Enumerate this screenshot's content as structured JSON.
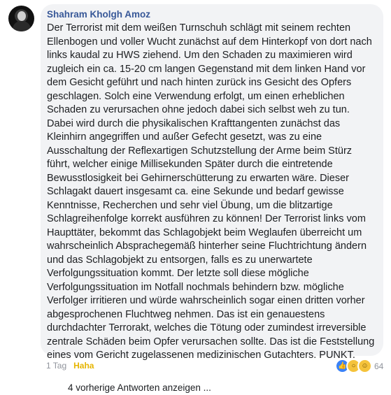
{
  "comment": {
    "author": "Shahram Kholgh Amoz",
    "text": "Der Terrorist mit dem weißen Turnschuh schlägt mit seinem rechten Ellenbogen und voller Wucht zunächst auf dem Hinterkopf von dort nach links kaudal zu HWS ziehend. Um den Schaden zu maximieren wird zugleich ein ca. 15-20 cm langen Gegenstand mit dem linken Hand vor dem Gesicht geführt und nach hinten zurück ins Gesicht des Opfers geschlagen. Solch eine Verwendung erfolgt, um einen erheblichen Schaden zu verursachen ohne jedoch dabei sich selbst weh zu tun. Dabei wird durch die physikalischen Krafttangenten zunächst das Kleinhirn angegriffen und außer Gefecht gesetzt, was zu eine Ausschaltung der Reflexartigen Schutzstellung der Arme beim Stürz führt, welcher einige Millisekunden Später durch die eintretende Bewusstlosigkeit bei Gehirnerschütterung zu erwarten wäre. Dieser Schlagakt dauert insgesamt ca. eine Sekunde und bedarf gewisse Kenntnisse, Recherchen und sehr viel Übung, um die blitzartige Schlagreihenfolge korrekt ausführen zu können! Der Terrorist links vom Haupttäter, bekommt das Schlagobjekt beim Weglaufen überreicht um wahrscheinlich Absprachegemäß hinterher seine Fluchtrichtung ändern und das Schlagobjekt zu entsorgen, falls es zu unerwartete Verfolgungssituation kommt. Der letzte soll diese mögliche Verfolgungssituation im Notfall nochmals behindern bzw. mögliche Verfolger irritieren und würde wahrscheinlich sogar einen dritten vorher abgesprochenen Fluchtweg nehmen. Das ist ein genauestens durchdachter Terrorakt, welches die Tötung oder zumindest irreversible zentrale Schäden beim Opfer verursachen sollte. Das ist die Feststellung eines vom Gericht zugelassenen medizinischen Gutachters. PUNKT.",
    "timestamp": "1 Tag",
    "reaction_action": "Haha",
    "reaction_icons": [
      "like-icon",
      "wow-icon",
      "haha-icon"
    ],
    "reaction_count": "64"
  },
  "replies": {
    "label": "4 vorherige Antworten anzeigen ..."
  },
  "colors": {
    "author": "#385898",
    "bubble": "#f2f3f5",
    "haha": "#e6b500",
    "meta": "#90949c"
  }
}
